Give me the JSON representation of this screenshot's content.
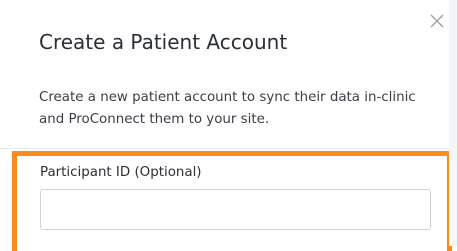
{
  "modal": {
    "title": "Create a Patient Account",
    "description": "Create a new patient account to sync their data in-clinic and ProConnect them to your site.",
    "close_icon": "close-icon"
  },
  "form": {
    "participant_id": {
      "label": "Participant ID (Optional)",
      "value": "",
      "placeholder": ""
    }
  },
  "colors": {
    "highlight": "#ff8a1f",
    "text": "#2b2f36",
    "input_border": "#cfd3d8"
  }
}
